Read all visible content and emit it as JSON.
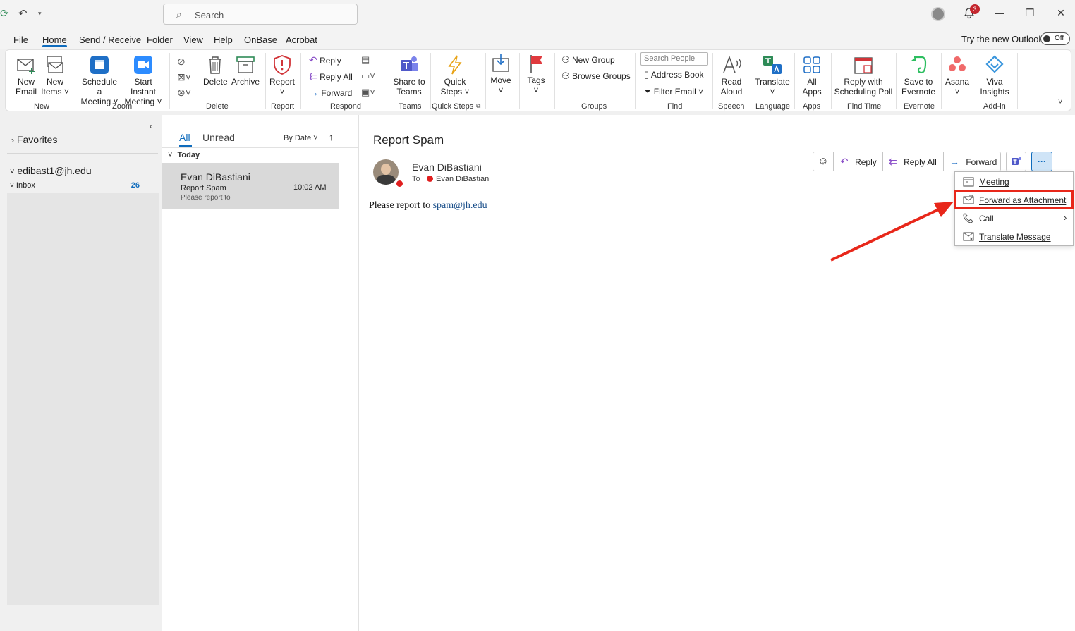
{
  "titlebar": {
    "search_placeholder": "Search",
    "notification_count": "3",
    "minimize": "—",
    "restore": "❐",
    "close": "✕"
  },
  "menu": {
    "tabs": [
      "File",
      "Home",
      "Send / Receive",
      "Folder",
      "View",
      "Help",
      "OnBase",
      "Acrobat"
    ],
    "try_new": "Try the new Outlook",
    "toggle_label": "Off"
  },
  "ribbon": {
    "new_email": [
      "New",
      "Email"
    ],
    "new_items": [
      "New",
      "Items ˅"
    ],
    "schedule_meeting": [
      "Schedule a",
      "Meeting ˅"
    ],
    "start_instant": [
      "Start Instant",
      "Meeting ˅"
    ],
    "delete": "Delete",
    "archive": "Archive",
    "report": [
      "Report",
      "˅"
    ],
    "reply": "Reply",
    "reply_all": "Reply All",
    "forward": "Forward",
    "share_to_teams": [
      "Share to",
      "Teams"
    ],
    "quick_steps": [
      "Quick",
      "Steps ˅"
    ],
    "move": [
      "Move",
      "˅"
    ],
    "tags": [
      "Tags",
      "˅"
    ],
    "new_group": "New Group",
    "browse_groups": "Browse Groups",
    "search_people_placeholder": "Search People",
    "address_book": "Address Book",
    "filter_email": "Filter Email ˅",
    "read_aloud": [
      "Read",
      "Aloud"
    ],
    "translate": [
      "Translate",
      "˅"
    ],
    "all_apps": [
      "All",
      "Apps"
    ],
    "reply_scheduling_poll": [
      "Reply with",
      "Scheduling Poll"
    ],
    "save_evernote": [
      "Save to",
      "Evernote"
    ],
    "asana": [
      "Asana",
      "˅"
    ],
    "viva_insights": [
      "Viva",
      "Insights"
    ],
    "groups": [
      "New",
      "Zoom",
      "Delete",
      "Report",
      "Respond",
      "Teams",
      "Quick Steps",
      "Groups",
      "Find",
      "Speech",
      "Language",
      "Apps",
      "Find Time",
      "Evernote",
      "Add-in"
    ]
  },
  "folders": {
    "favorites": "Favorites",
    "account": "edibast1@jh.edu",
    "inbox": "Inbox",
    "inbox_count": "26"
  },
  "message_list": {
    "filter_all": "All",
    "filter_unread": "Unread",
    "sort": "By Date ˅",
    "group_today": "Today",
    "items": [
      {
        "sender": "Evan DiBastiani",
        "subject": "Report Spam",
        "preview": "Please report to",
        "time": "10:02 AM"
      }
    ]
  },
  "reading": {
    "subject": "Report Spam",
    "sender": "Evan DiBastiani",
    "to_label": "To",
    "recipient": "Evan DiBastiani",
    "body_text": "Please report to ",
    "body_link": "spam@jh.edu",
    "actions": {
      "reply": "Reply",
      "reply_all": "Reply All",
      "forward": "Forward",
      "more": "···"
    },
    "menu": [
      "Meeting",
      "Forward as Attachment",
      "Call",
      "Translate Message"
    ]
  },
  "colors": {
    "accent": "#0f6cbd",
    "highlight": "#e8271a",
    "presence_busy": "#e01e1e"
  }
}
